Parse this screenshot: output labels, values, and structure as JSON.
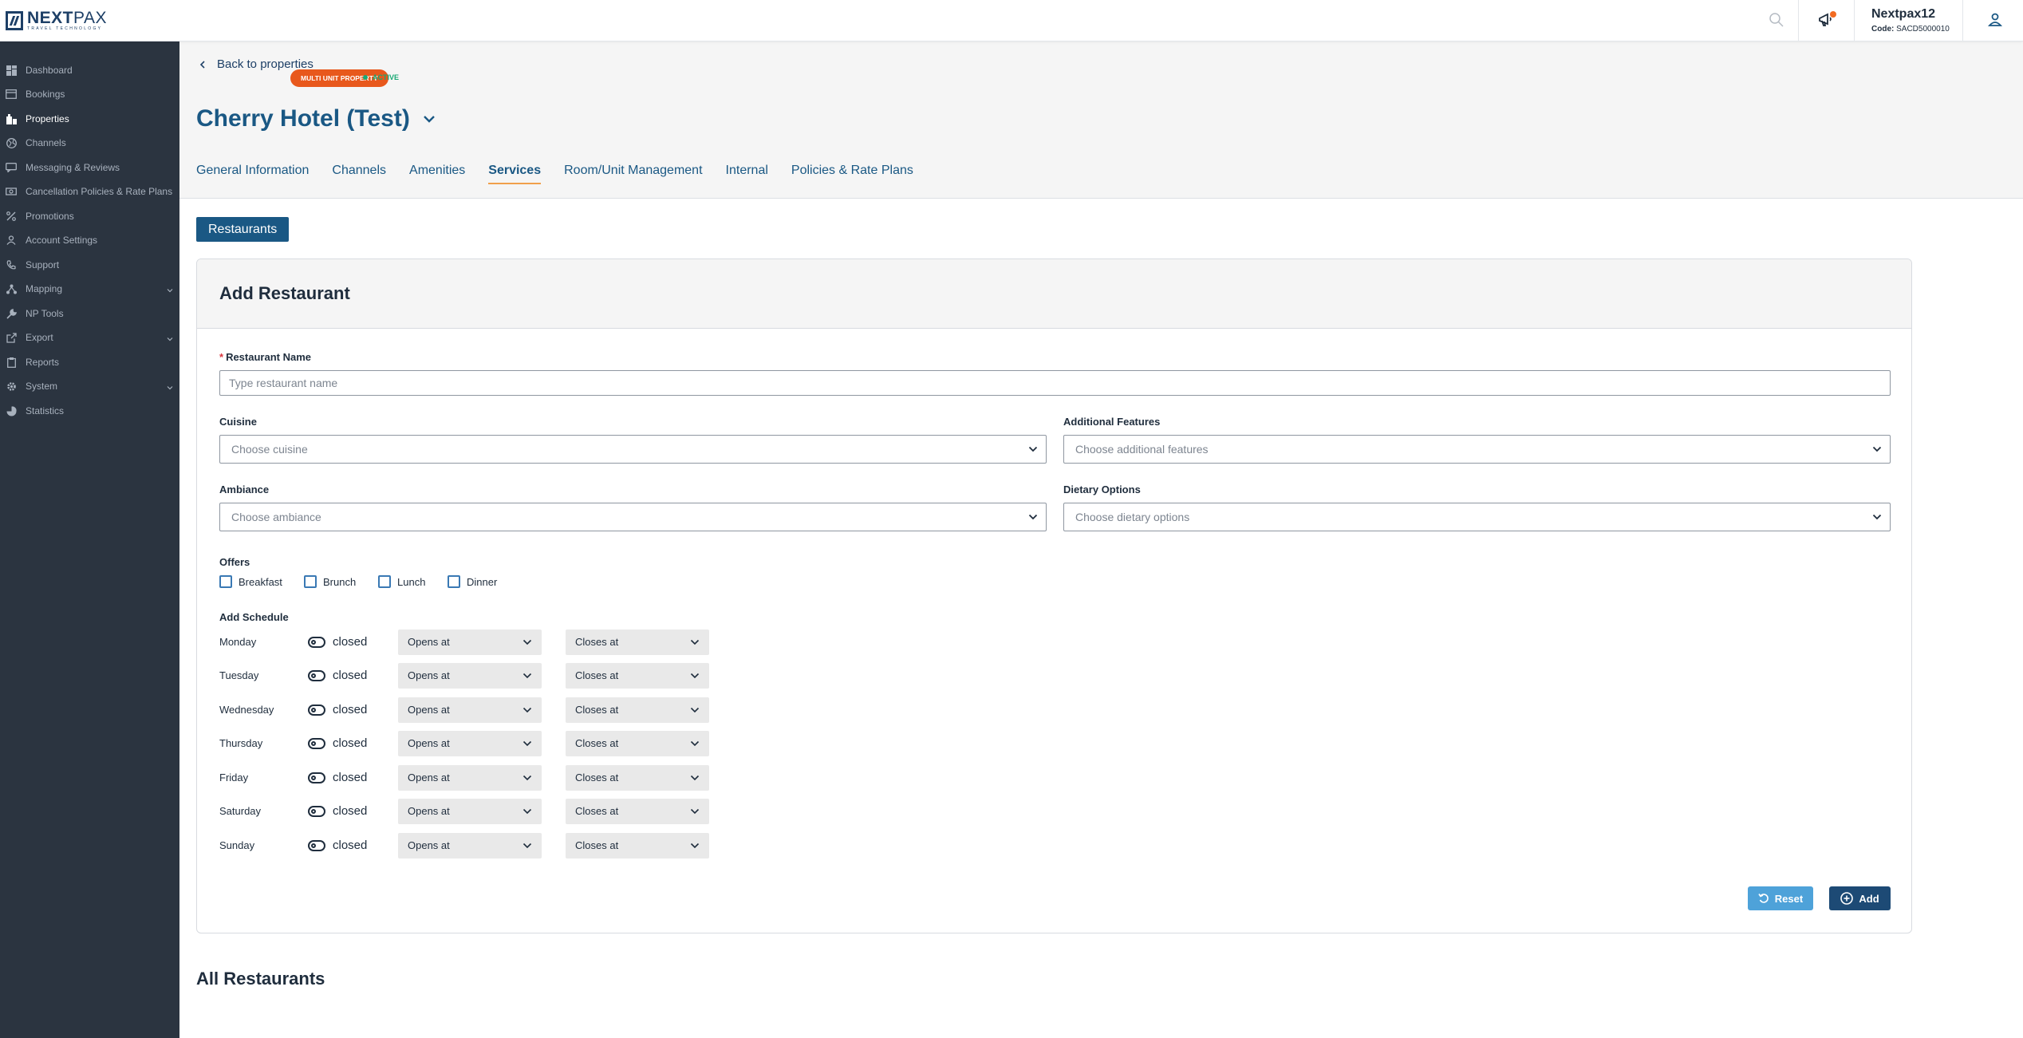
{
  "brand": {
    "name_bold": "NEXT",
    "name_light": "PAX",
    "tagline": "TRAVEL TECHNOLOGY"
  },
  "account": {
    "name": "Nextpax12",
    "code_label": "Code:",
    "code_value": "SACD5000010"
  },
  "sidebar": {
    "items": [
      {
        "label": "Dashboard",
        "icon": "dashboard-icon"
      },
      {
        "label": "Bookings",
        "icon": "bookings-icon"
      },
      {
        "label": "Properties",
        "icon": "properties-icon",
        "active": true
      },
      {
        "label": "Channels",
        "icon": "globe-icon"
      },
      {
        "label": "Messaging & Reviews",
        "icon": "message-icon"
      },
      {
        "label": "Cancellation Policies & Rate Plans",
        "icon": "money-icon"
      },
      {
        "label": "Promotions",
        "icon": "percent-icon"
      },
      {
        "label": "Account Settings",
        "icon": "user-icon"
      },
      {
        "label": "Support",
        "icon": "phone-icon"
      },
      {
        "label": "Mapping",
        "icon": "mapping-icon",
        "expandable": true
      },
      {
        "label": "NP Tools",
        "icon": "wrench-icon"
      },
      {
        "label": "Export",
        "icon": "export-icon",
        "expandable": true
      },
      {
        "label": "Reports",
        "icon": "clipboard-icon"
      },
      {
        "label": "System",
        "icon": "gear-icon",
        "expandable": true
      },
      {
        "label": "Statistics",
        "icon": "chart-icon"
      }
    ]
  },
  "header": {
    "back_label": "Back to properties",
    "property_name": "Cherry Hotel (Test)",
    "badge_type": "MULTI UNIT PROPERTY",
    "badge_status": "ACTIVE",
    "tabs": [
      {
        "label": "General Information"
      },
      {
        "label": "Channels"
      },
      {
        "label": "Amenities"
      },
      {
        "label": "Services",
        "active": true
      },
      {
        "label": "Room/Unit Management"
      },
      {
        "label": "Internal"
      },
      {
        "label": "Policies & Rate Plans"
      }
    ]
  },
  "subtab": {
    "label": "Restaurants"
  },
  "form": {
    "title": "Add Restaurant",
    "required_mark": "*",
    "name_label": "Restaurant Name",
    "name_placeholder": "Type restaurant name",
    "cuisine_label": "Cuisine",
    "cuisine_placeholder": "Choose cuisine",
    "features_label": "Additional Features",
    "features_placeholder": "Choose additional features",
    "ambiance_label": "Ambiance",
    "ambiance_placeholder": "Choose ambiance",
    "dietary_label": "Dietary Options",
    "dietary_placeholder": "Choose dietary options",
    "offers_label": "Offers",
    "offers": [
      "Breakfast",
      "Brunch",
      "Lunch",
      "Dinner"
    ],
    "schedule_label": "Add Schedule",
    "schedule": [
      {
        "day": "Monday",
        "status": "closed",
        "opens": "Opens at",
        "closes": "Closes at"
      },
      {
        "day": "Tuesday",
        "status": "closed",
        "opens": "Opens at",
        "closes": "Closes at"
      },
      {
        "day": "Wednesday",
        "status": "closed",
        "opens": "Opens at",
        "closes": "Closes at"
      },
      {
        "day": "Thursday",
        "status": "closed",
        "opens": "Opens at",
        "closes": "Closes at"
      },
      {
        "day": "Friday",
        "status": "closed",
        "opens": "Opens at",
        "closes": "Closes at"
      },
      {
        "day": "Saturday",
        "status": "closed",
        "opens": "Opens at",
        "closes": "Closes at"
      },
      {
        "day": "Sunday",
        "status": "closed",
        "opens": "Opens at",
        "closes": "Closes at"
      }
    ],
    "reset_label": "Reset",
    "add_label": "Add"
  },
  "list": {
    "title": "All Restaurants"
  },
  "colors": {
    "primary": "#1a5884",
    "sidebar": "#2b3440",
    "accent_orange": "#e8581c",
    "status_green": "#19a974"
  }
}
